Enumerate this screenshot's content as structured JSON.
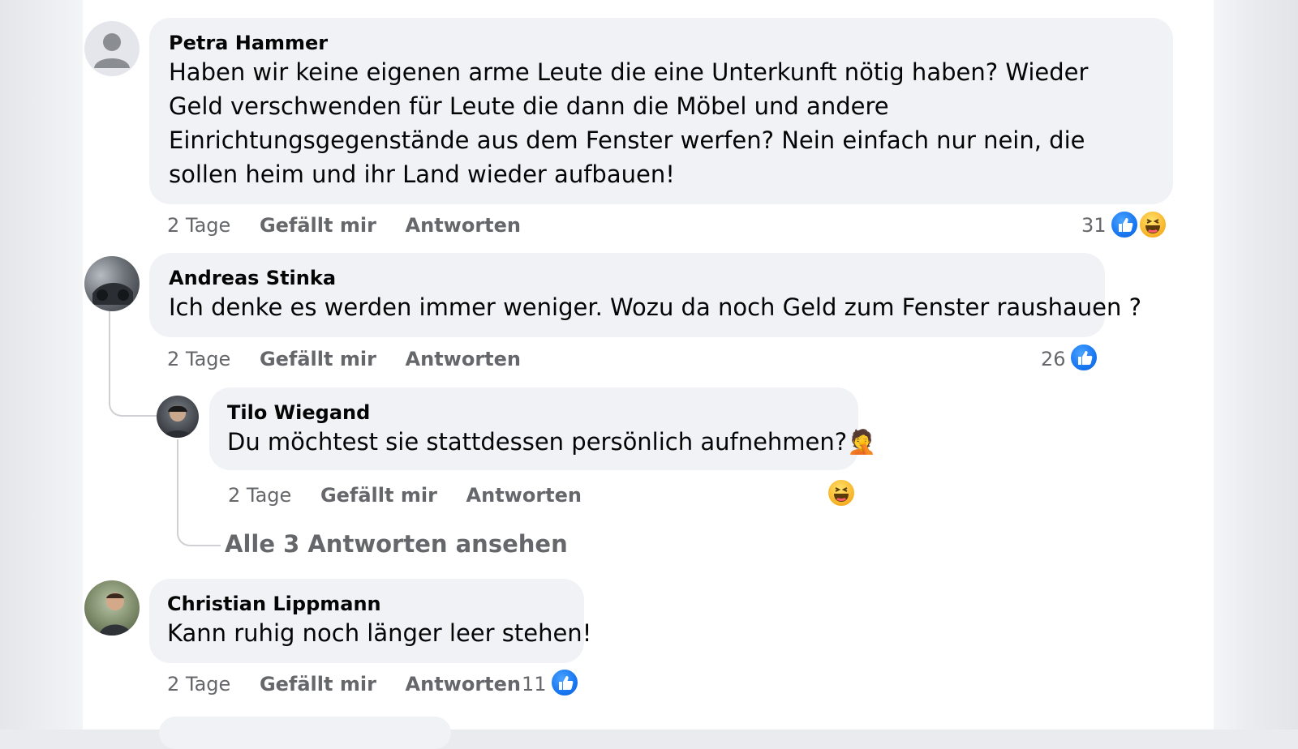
{
  "comments": [
    {
      "author": "Petra Hammer",
      "text": "Haben wir keine eigenen arme Leute die eine Unterkunft nötig haben? Wieder Geld verschwenden für Leute die dann die Möbel und andere Einrichtungsgegenstände aus dem Fenster werfen? Nein einfach nur nein, die sollen heim und ihr Land wieder aufbauen!",
      "time": "2 Tage",
      "like_label": "Gefällt mir",
      "reply_label": "Antworten",
      "reaction_count": "31",
      "reactions": [
        "like-icon",
        "haha-icon"
      ]
    },
    {
      "author": "Andreas Stinka",
      "text": "Ich denke es werden immer weniger. Wozu da noch Geld zum Fenster raushauen ?",
      "time": "2 Tage",
      "like_label": "Gefällt mir",
      "reply_label": "Antworten",
      "reaction_count": "26",
      "reactions": [
        "like-icon"
      ],
      "reply": {
        "author": "Tilo Wiegand",
        "text": "Du möchtest sie stattdessen persönlich aufnehmen?",
        "emoji": "🤦",
        "time": "2 Tage",
        "like_label": "Gefällt mir",
        "reply_label": "Antworten",
        "reactions": [
          "haha-icon"
        ]
      },
      "view_replies": "Alle 3 Antworten ansehen"
    },
    {
      "author": "Christian Lippmann",
      "text": "Kann ruhig noch länger leer stehen!",
      "time": "2 Tage",
      "like_label": "Gefällt mir",
      "reply_label": "Antworten",
      "reaction_count": "11",
      "reactions": [
        "like-icon"
      ]
    }
  ],
  "colors": {
    "bubble": "#f0f2f5",
    "meta_text": "#65676b",
    "like_blue": "#1877f2",
    "haha_yellow": "#f7b125"
  }
}
